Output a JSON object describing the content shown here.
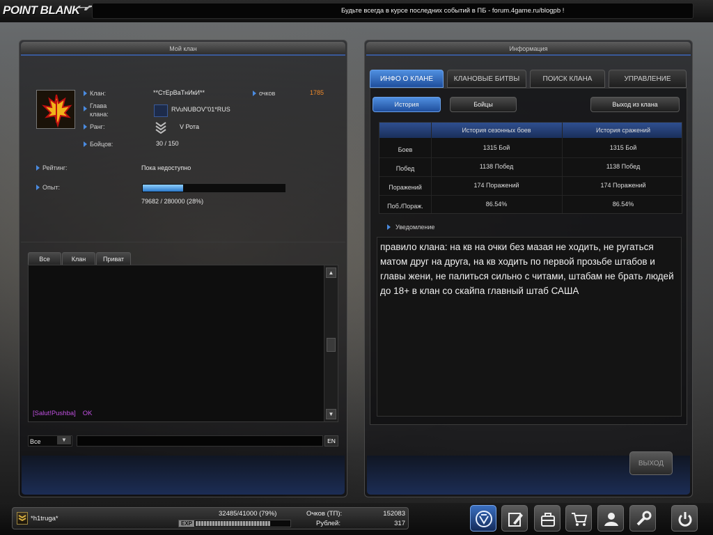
{
  "top": {
    "logo": "POINT BLANK",
    "news": "Будьте всегда в курсе последних событий в ПБ - forum.4game.ru/blogpb !"
  },
  "left_panel": {
    "title": "Мой клан",
    "clan_label": "Клан:",
    "clan_name": "**СтЕрВаТнИкИ**",
    "points_label": "очков",
    "points_value": "1785",
    "leader_label": "Глава клана:",
    "leader_name": "RVuNUBOV\"01*RUS",
    "rank_label": "Ранг:",
    "rank_value": "V Рота",
    "members_label": "Бойцов:",
    "members_value": "30 / 150",
    "rating_label": "Рейтинг:",
    "rating_value": "Пока недоступно",
    "exp_label": "Опыт:",
    "exp_text": "79682 / 280000 (28%)",
    "exp_fraction": 0.28
  },
  "chat": {
    "tabs": [
      "Все",
      "Клан",
      "Приват"
    ],
    "messages": [
      {
        "name": "[Salut!Pushba]",
        "text": "OK"
      }
    ],
    "channel": "Все",
    "lang": "EN",
    "scroll_up": "▲",
    "scroll_down": "▼",
    "channel_arrow": "▼"
  },
  "right_panel": {
    "title": "Информация",
    "tabs": [
      "ИНФО О КЛАНЕ",
      "КЛАНОВЫЕ БИТВЫ",
      "ПОИСК КЛАНА",
      "УПРАВЛЕНИЕ"
    ],
    "active_tab": 0,
    "sub_buttons": {
      "history": "История",
      "fighters": "Бойцы",
      "leave": "Выход из клана"
    },
    "table": {
      "headers": [
        "История сезонных боев",
        "История сражений"
      ],
      "rows": [
        {
          "label": "Боев",
          "season": "1315  Бой",
          "total": "1315  Бой"
        },
        {
          "label": "Побед",
          "season": "1138 Побед",
          "total": "1138 Побед"
        },
        {
          "label": "Поражений",
          "season": "174 Поражений",
          "total": "174 Поражений"
        },
        {
          "label": "Поб./Пораж.",
          "season": "86.54%",
          "total": "86.54%"
        }
      ]
    },
    "notice_label": "Уведомление",
    "notice_text": "правило клана: на кв на очки без мазая не ходить, не ругаться матом друг на друга, на кв ходить по первой прозьбе штабов и главы жени, не палиться сильно с читами, штабам не брать людей до 18+ в клан со скайпа  главный штаб САША",
    "exit_button": "ВЫХОД"
  },
  "bottom": {
    "nickname": "*h1truga*",
    "exp_text": "32485/41000 (79%)",
    "exp_fraction": 0.79,
    "exp_tag": "EXP",
    "points_label": "Очков (ТП):",
    "points_value": "152083",
    "rubles_label": "Рублей:",
    "rubles_value": "317",
    "dock": [
      "clan-icon",
      "edit-icon",
      "inventory-icon",
      "shop-icon",
      "community-icon",
      "settings-icon",
      "power-icon"
    ]
  }
}
